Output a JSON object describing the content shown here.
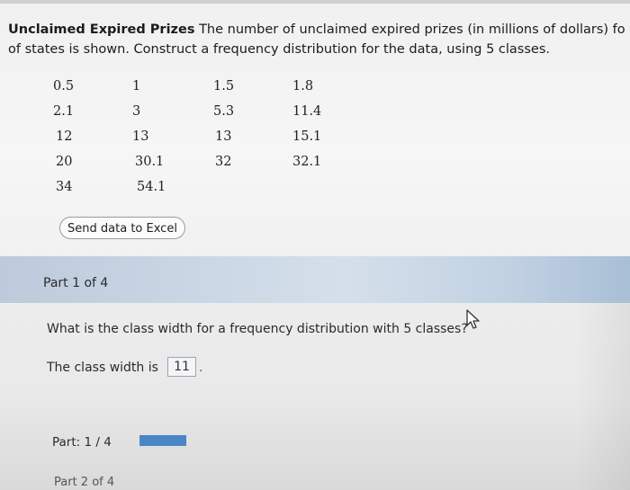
{
  "problem": {
    "title": "Unclaimed Expired Prizes",
    "line1": "The number of unclaimed expired prizes (in millions of dollars) fo",
    "line2": "of states is shown. Construct a frequency distribution for the data, using 5 classes."
  },
  "data_table": {
    "rows": [
      [
        "0.5",
        "1",
        "1.5",
        "1.8"
      ],
      [
        "2.1",
        "3",
        "5.3",
        "11.4"
      ],
      [
        "12",
        "13",
        "13",
        "15.1"
      ],
      [
        "20",
        "30.1",
        "32",
        "32.1"
      ],
      [
        "34",
        "54.1",
        "",
        ""
      ]
    ]
  },
  "excel_button": {
    "label": "Send data to Excel"
  },
  "part": {
    "label": "Part 1 of 4"
  },
  "question": {
    "text": "What is the class width for a frequency distribution with 5 classes?"
  },
  "answer": {
    "prefix": "The class width is",
    "value": "11",
    "suffix": "."
  },
  "progress": {
    "label": "Part: 1 / 4",
    "fraction": 0.25
  },
  "next_part": {
    "label": "Part 2 of 4"
  },
  "colors": {
    "progress_fill": "#4a86c5",
    "band": "#c9d6e4"
  },
  "icons": {
    "cursor": "mouse-pointer-icon"
  }
}
